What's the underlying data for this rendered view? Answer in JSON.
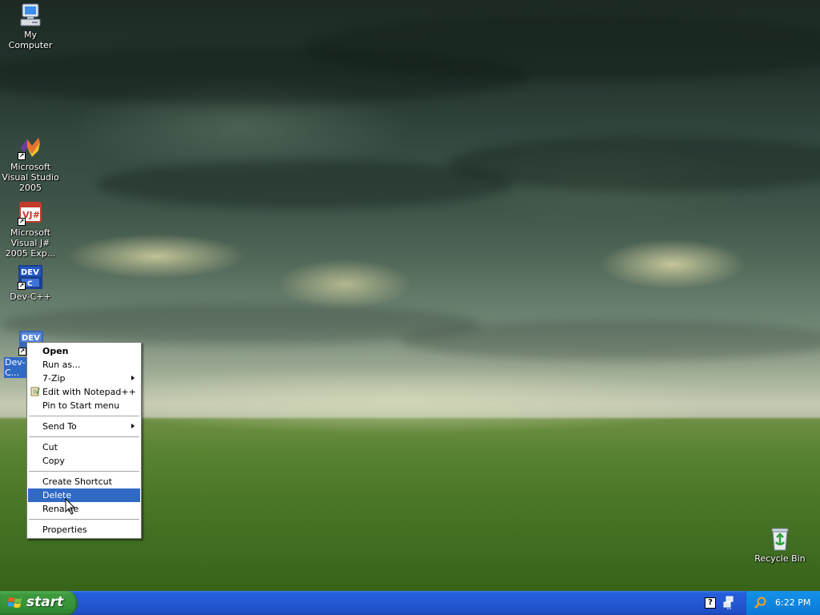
{
  "desktop": {
    "icons": [
      {
        "label": "My Computer"
      },
      {
        "label": "Microsoft Visual Studio 2005"
      },
      {
        "label": "Microsoft Visual J# 2005 Exp..."
      },
      {
        "label": "Dev-C++"
      },
      {
        "label": "Dev-C..."
      },
      {
        "label": "Recycle Bin"
      }
    ]
  },
  "context_menu": {
    "items": [
      {
        "label": "Open",
        "icon": null
      },
      {
        "label": "Run as...",
        "icon": null
      },
      {
        "label": "7-Zip",
        "icon": null
      },
      {
        "label": "Edit with Notepad++",
        "icon": "notepad-icon"
      },
      {
        "label": "Pin to Start menu",
        "icon": null
      },
      {
        "label": "Send To",
        "icon": null
      },
      {
        "label": "Cut",
        "icon": null
      },
      {
        "label": "Copy",
        "icon": null
      },
      {
        "label": "Create Shortcut",
        "icon": null
      },
      {
        "label": "Delete",
        "icon": null
      },
      {
        "label": "Rename",
        "icon": null
      },
      {
        "label": "Properties",
        "icon": null
      }
    ]
  },
  "taskbar": {
    "start_label": "start",
    "clock": "6:22 PM",
    "help_glyph": "?"
  },
  "colors": {
    "selection": "#316ac5",
    "taskbar_blue": "#245edb",
    "start_green": "#3c9a3c",
    "tray_blue": "#0e86e1"
  }
}
